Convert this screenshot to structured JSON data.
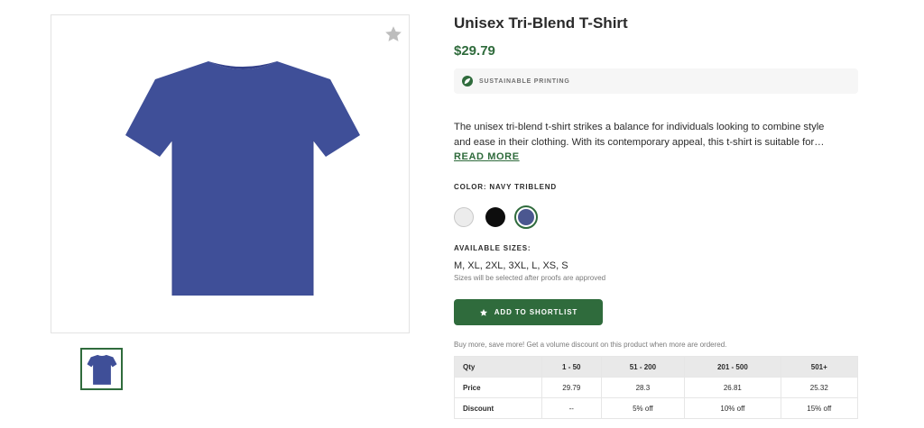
{
  "product": {
    "title": "Unisex Tri-Blend T-Shirt",
    "price": "$29.79",
    "badge": "SUSTAINABLE PRINTING",
    "description_lines": [
      "The unisex tri-blend t-shirt strikes a balance for individuals looking to combine style",
      "and ease in their clothing. With its contemporary appeal, this t-shirt is suitable for…"
    ],
    "read_more": "READ MORE"
  },
  "colors": {
    "label": "COLOR: NAVY TRIBLEND",
    "swatches": [
      {
        "name": "white",
        "hex": "#ececec",
        "selected": false
      },
      {
        "name": "black",
        "hex": "#0d0d0d",
        "selected": false
      },
      {
        "name": "navy triblend",
        "hex": "#4b5790",
        "selected": true
      }
    ]
  },
  "sizes": {
    "label": "AVAILABLE SIZES:",
    "list": "M, XL, 2XL, 3XL, L, XS, S",
    "note": "Sizes will be selected after proofs are approved"
  },
  "actions": {
    "shortlist_label": "ADD TO SHORTLIST"
  },
  "volume": {
    "note": "Buy more, save more! Get a volume discount on this product when more are ordered.",
    "table": {
      "header": [
        "Qty",
        "1 - 50",
        "51 - 200",
        "201 - 500",
        "501+"
      ],
      "rows": [
        [
          "Price",
          "29.79",
          "28.3",
          "26.81",
          "25.32"
        ],
        [
          "Discount",
          "--",
          "5% off",
          "10% off",
          "15% off"
        ]
      ]
    }
  },
  "theme": {
    "accent": "#2f6b3c",
    "shirt_color": "#3f4f98"
  },
  "icons": {
    "favorite": "star-icon",
    "badge": "leaf-icon",
    "button": "star-icon"
  }
}
